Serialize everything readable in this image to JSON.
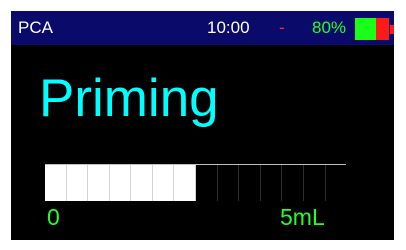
{
  "status_bar": {
    "app_name": "PCA",
    "time": "10:00",
    "separator": "-",
    "battery_percent": "80%",
    "battery_level": 0.62,
    "colors": {
      "background": "#0a0a6b",
      "battery_ok": "#19ff19",
      "battery_empty": "#ff1a1a",
      "separator": "#ff2a2a"
    }
  },
  "main": {
    "mode_title": "Priming",
    "title_color": "#00ffff"
  },
  "progress": {
    "fraction": 0.5,
    "segment_count": 14,
    "min_label": "0",
    "max_label": "5mL",
    "label_color": "#22ff22"
  }
}
